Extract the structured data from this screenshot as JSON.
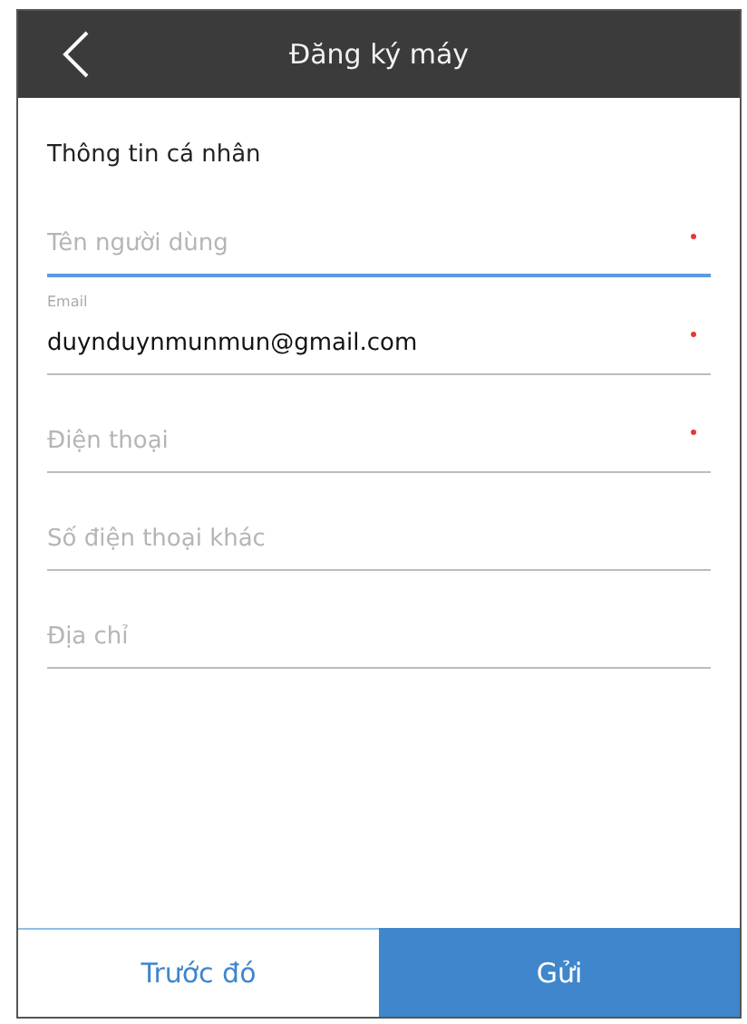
{
  "header": {
    "title": "Đăng ký máy"
  },
  "section_title": "Thông tin cá nhân",
  "fields": [
    {
      "placeholder": "Tên người dùng",
      "required": true,
      "focused": true
    },
    {
      "label": "Email",
      "value": "duynduynmunmun@gmail.com",
      "required": true,
      "focused": false
    },
    {
      "placeholder": "Điện thoại",
      "required": true,
      "focused": false
    },
    {
      "placeholder": "Số điện thoại khác",
      "required": false,
      "focused": false
    },
    {
      "placeholder": "Địa chỉ",
      "required": false,
      "focused": false
    }
  ],
  "buttons": [
    {
      "label": "Trước đó",
      "primary": false
    },
    {
      "label": "Gửi",
      "primary": true
    }
  ]
}
